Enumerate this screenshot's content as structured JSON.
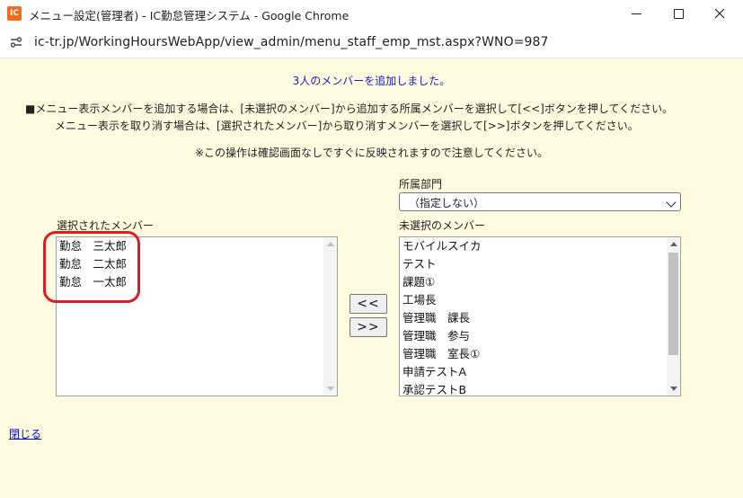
{
  "window": {
    "title": "メニュー設定(管理者) - IC勤怠管理システム - Google Chrome",
    "icon_text": "IC",
    "url": "ic-tr.jp/WorkingHoursWebApp/view_admin/menu_staff_emp_mst.aspx?WNO=987"
  },
  "page": {
    "message": "3人のメンバーを追加しました。",
    "instruction_1": "■メニュー表示メンバーを追加する場合は、[未選択のメンバー]から追加する所属メンバーを選択して[<<]ボタンを押してください。",
    "instruction_2": "メニュー表示を取り消す場合は、[選択されたメンバー]から取り消すメンバーを選択して[>>]ボタンを押してください。",
    "note": "※この操作は確認画面なしですぐに反映されますので注意してください。",
    "dept_label": "所属部門",
    "dept_selected": "（指定しない）",
    "selected_label": "選択されたメンバー",
    "unselected_label": "未選択のメンバー",
    "add_button": "<<",
    "remove_button": ">>",
    "close_link": "閉じる"
  },
  "selected_members": [
    "勤怠　三太郎",
    "勤怠　二太郎",
    "勤怠　一太郎"
  ],
  "unselected_members": [
    "モバイルスイカ",
    "テスト",
    "課題①",
    "工場長",
    "管理職　課長",
    "管理職　参与",
    "管理職　室長①",
    "申請テストA",
    "承認テストB"
  ],
  "colors": {
    "highlight": "#e01b24",
    "message": "#1a1acc",
    "background": "#fffbe0"
  }
}
